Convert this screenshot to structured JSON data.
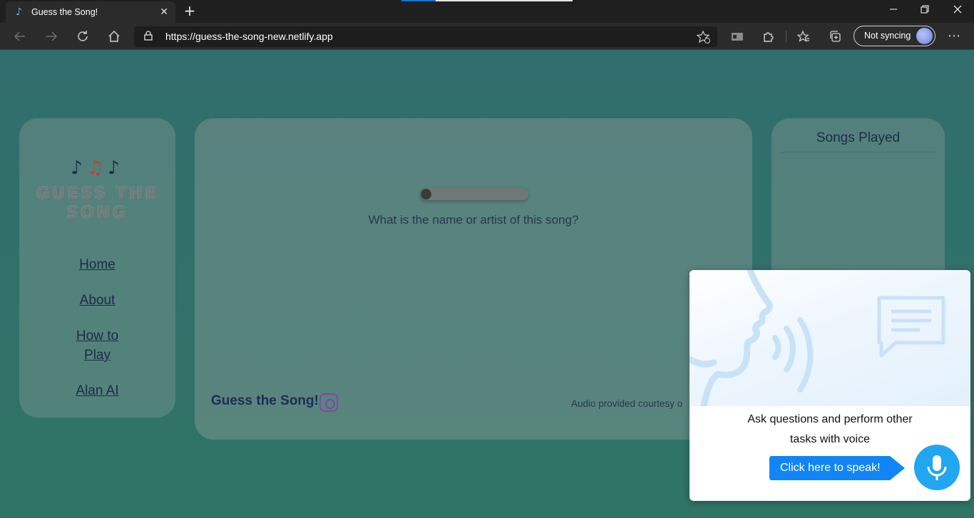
{
  "browser": {
    "tab_title": "Guess the Song!",
    "tab_close": "✕",
    "new_tab": "+",
    "url": "https://guess-the-song-new.netlify.app",
    "sync_label": "Not syncing",
    "more": "⋯"
  },
  "sidebar": {
    "logo_line1": "GUESS THE",
    "logo_line2": "SONG",
    "nav": [
      {
        "label": "Home"
      },
      {
        "label": "About"
      },
      {
        "label": "How to"
      },
      {
        "label": "Play"
      },
      {
        "label": "Alan AI"
      }
    ]
  },
  "player": {
    "progress": 0,
    "question": "What is the name or artist of this song?"
  },
  "footer": {
    "brand": "Guess the Song!",
    "credit": "Audio provided courtesy o"
  },
  "songs_panel": {
    "title": "Songs Played"
  },
  "voice_popup": {
    "line1": "Ask questions and perform other",
    "line2": "tasks with voice",
    "button_label": "Click here to speak!"
  },
  "colors": {
    "page_bg": "#2f7068",
    "accent_blue": "#1185f5",
    "mic_blue": "#21a6f2",
    "nav_text": "#1d2a4a"
  }
}
